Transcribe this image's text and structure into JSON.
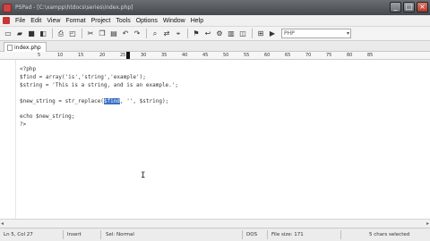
{
  "window": {
    "title": "PSPad - [C:\\xampp\\htdocs\\series\\index.php]",
    "controls": [
      "_",
      "□",
      "×"
    ]
  },
  "menu": [
    "File",
    "Edit",
    "View",
    "Format",
    "Project",
    "Tools",
    "Options",
    "Window",
    "Help"
  ],
  "toolbar": {
    "syntax": "PHP"
  },
  "tabs": [
    {
      "label": "index.php"
    }
  ],
  "ruler": {
    "marks": [
      "5",
      "10",
      "15",
      "20",
      "25",
      "30",
      "35",
      "40",
      "45",
      "50",
      "55",
      "60",
      "65",
      "70",
      "75",
      "80",
      "85"
    ]
  },
  "editor": {
    "lines": [
      "<?php",
      "$find = array('is','string','example');",
      "$string = 'This is a string, and is an example.';",
      "",
      "",
      "echo $new_string;",
      "?>"
    ],
    "replace_line": {
      "before": "$new_string = str_replace(",
      "selected": "$find",
      "after": ", '', $string);"
    }
  },
  "status": {
    "position": "Ln 5, Col 27",
    "mode": "Insert",
    "selection_mode": "Sel: Normal",
    "format": "DOS",
    "file_size": "File size: 171",
    "chars_selected": "5 chars selected"
  }
}
